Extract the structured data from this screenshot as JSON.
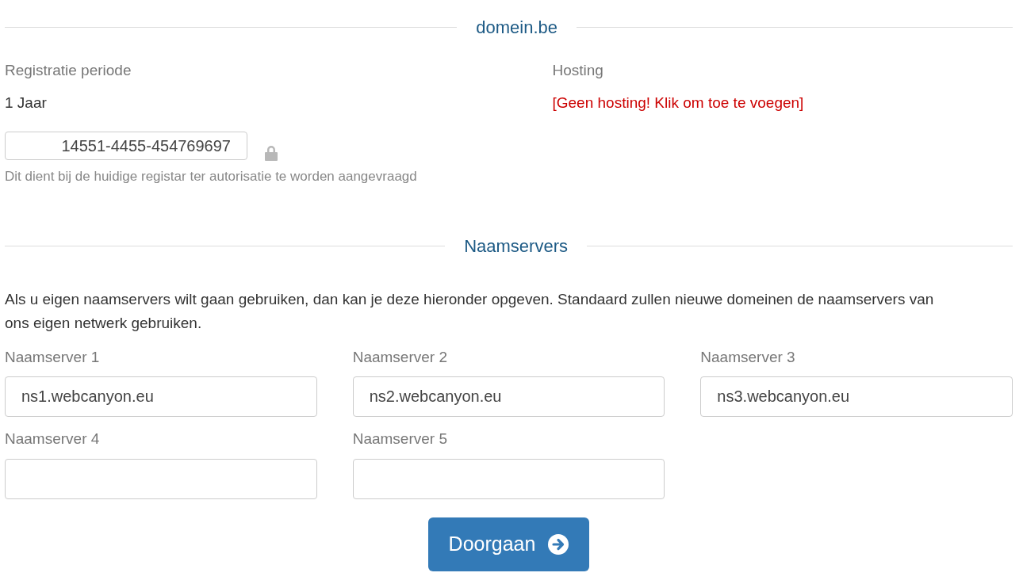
{
  "domain_heading": "domein.be",
  "registration": {
    "label": "Registratie periode",
    "value": "1 Jaar"
  },
  "hosting": {
    "label": "Hosting",
    "link": "[Geen hosting! Klik om toe te voegen]"
  },
  "auth_code": {
    "value": "14551-4455-454769697",
    "locked": true,
    "help": "Dit dient bij de huidige registar ter autorisatie te worden aangevraagd"
  },
  "nameservers_heading": "Naamservers",
  "intro": "Als u eigen naamservers wilt gaan gebruiken, dan kan je deze hieronder opgeven. Standaard zullen nieuwe domeinen de naamservers van ons eigen netwerk gebruiken.",
  "nameservers": [
    {
      "label": "Naamserver 1",
      "value": "ns1.webcanyon.eu"
    },
    {
      "label": "Naamserver 2",
      "value": "ns2.webcanyon.eu"
    },
    {
      "label": "Naamserver 3",
      "value": "ns3.webcanyon.eu"
    },
    {
      "label": "Naamserver 4"
    },
    {
      "label": "Naamserver 5"
    }
  ],
  "continue_button": "Doorgaan"
}
